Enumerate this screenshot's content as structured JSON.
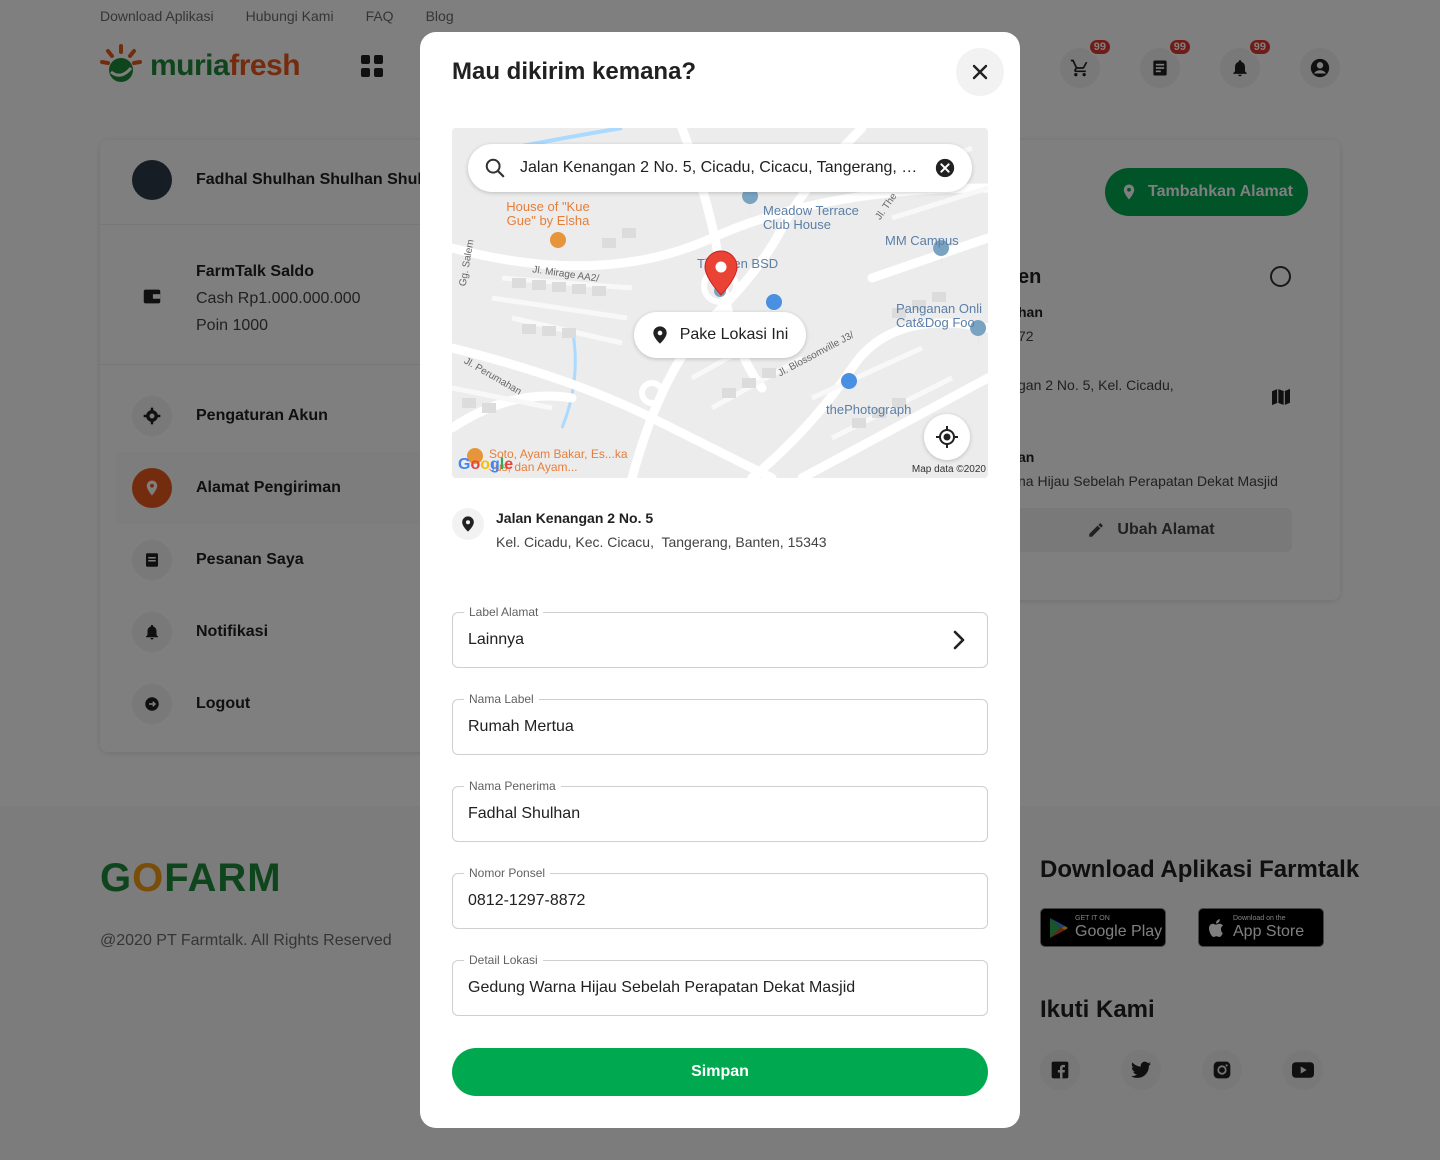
{
  "topnav": {
    "items": [
      "Download Aplikasi",
      "Hubungi Kami",
      "FAQ",
      "Blog"
    ]
  },
  "header": {
    "logo_text_a": "muria",
    "logo_text_b": "fresh",
    "cart_badge": "99",
    "orders_badge": "99",
    "notif_badge": "99"
  },
  "sidebar": {
    "profile_name": "Fadhal Shulhan Shulhan Shulh...",
    "saldo_title": "FarmTalk Saldo",
    "saldo_cash": "Cash Rp1.000.000.000",
    "saldo_poin": "Poin 1000",
    "menu": [
      {
        "label": "Pengaturan Akun",
        "icon": "gear-icon"
      },
      {
        "label": "Alamat Pengiriman",
        "icon": "location-pin-icon"
      },
      {
        "label": "Pesanan Saya",
        "icon": "receipt-icon"
      },
      {
        "label": "Notifikasi",
        "icon": "bell-icon"
      },
      {
        "label": "Logout",
        "icon": "logout-icon"
      }
    ]
  },
  "content": {
    "add_address_label": "Tambahkan Alamat",
    "address_title_partial": "en",
    "line1_partial": "han",
    "line2_partial": "72",
    "line3_partial": "gan 2 No. 5, Kel. Cicadu,",
    "line4_partial": "an",
    "line5_partial": "na Hijau Sebelah Perapatan Dekat Masjid",
    "edit_address_label": "Ubah Alamat"
  },
  "footer": {
    "copyright": "@2020 PT Farmtalk. All Rights Reserved",
    "download_title": "Download Aplikasi Farmtalk",
    "google_play_small": "GET IT ON",
    "google_play_big": "Google Play",
    "app_store_small": "Download on the",
    "app_store_big": "App Store",
    "follow_title": "Ikuti Kami"
  },
  "modal": {
    "title": "Mau dikirim kemana?",
    "map": {
      "search_value": "Jalan Kenangan 2 No. 5, Cicadu, Cicacu, Tangerang, Ba...",
      "use_location_label": "Pake Lokasi Ini",
      "attribution": "Map data ©2020",
      "google": "Google",
      "places": {
        "house_of_kue": "House of \"Kue Gue\" by Elsha",
        "meadow": "Meadow Terrace Club House",
        "mm_campus": "MM Campus",
        "green_bsd": "Ti    reen BSD",
        "panganan": "Panganan Onli Cat&Dog Foo",
        "photograph": "thePhotograph",
        "soto": "Soto, Ayam Bakar, Es...ka Jus, dan Ayam...",
        "jl_mirage": "Jl. Mirage AA2/",
        "gg_salem": "Gg. Salem",
        "jl_perumahan": "Jl. Perumahan",
        "jl_blossomville": "Jl. Blossomville J3/",
        "jl_the": "Jl. The"
      }
    },
    "address": {
      "name": "Jalan Kenangan 2 No. 5",
      "detail": "Kel. Cicadu, Kec. Cicacu,  Tangerang, Banten, 15343"
    },
    "fields": {
      "label_alamat": {
        "label": "Label Alamat",
        "value": "Lainnya"
      },
      "nama_label": {
        "label": "Nama Label",
        "value": "Rumah Mertua"
      },
      "nama_penerima": {
        "label": "Nama Penerima",
        "value": "Fadhal Shulhan"
      },
      "nomor_ponsel": {
        "label": "Nomor Ponsel",
        "value": "0812-1297-8872"
      },
      "detail_lokasi": {
        "label": "Detail Lokasi",
        "value": "Gedung Warna Hijau Sebelah Perapatan Dekat Masjid"
      }
    },
    "save_label": "Simpan"
  },
  "colors": {
    "primary": "#00a84f",
    "brand_orange": "#e8581c",
    "badge": "#e53935",
    "pin": "#ea4335"
  }
}
